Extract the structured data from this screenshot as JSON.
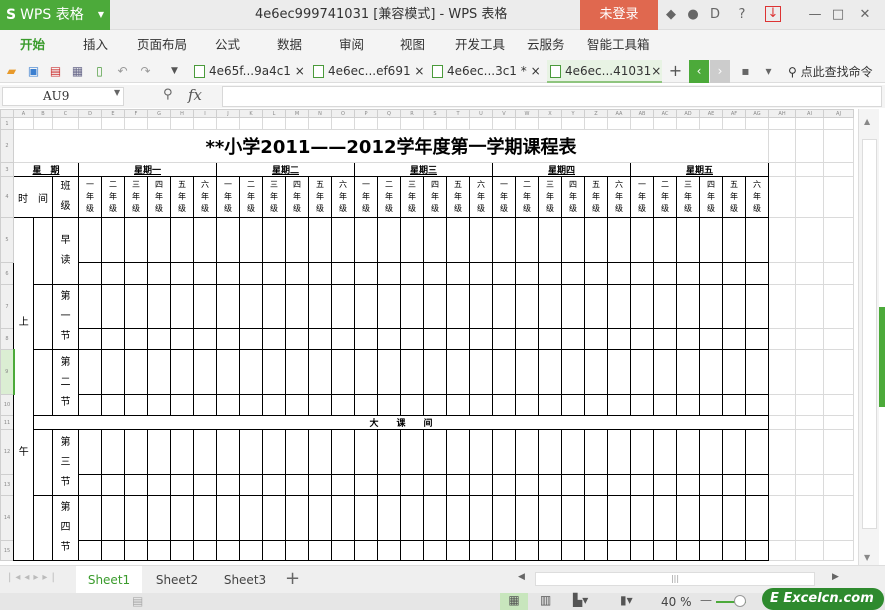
{
  "app": {
    "name": "WPS 表格",
    "logo_letter": "S",
    "doc_title": "4e6ec999741031 [兼容模式] - WPS 表格",
    "login": "未登录"
  },
  "menu": [
    "开始",
    "插入",
    "页面布局",
    "公式",
    "数据",
    "审阅",
    "视图",
    "开发工具",
    "云服务",
    "智能工具箱"
  ],
  "doc_tabs": [
    {
      "label": "4e65f...9a4c1 ×"
    },
    {
      "label": "4e6ec...ef691 ×"
    },
    {
      "label": "4e6ec...3c1 * ×"
    },
    {
      "label": "4e6ec...41031×"
    }
  ],
  "search_command": "点此查找命令",
  "formula": {
    "cell_ref": "AU9",
    "fx": "fx",
    "value": ""
  },
  "columns": [
    "A",
    "B",
    "C",
    "D",
    "E",
    "F",
    "G",
    "H",
    "I",
    "J",
    "K",
    "L",
    "M",
    "N",
    "O",
    "P",
    "Q",
    "R",
    "S",
    "T",
    "U",
    "V",
    "W",
    "X",
    "Y",
    "Z",
    "AA",
    "AB",
    "AC",
    "AD",
    "AE",
    "AF",
    "AG",
    "AH",
    "AI",
    "AJ"
  ],
  "rows": [
    "1",
    "2",
    "3",
    "4",
    "5",
    "6",
    "7",
    "8",
    "9",
    "10",
    "11",
    "12",
    "13",
    "14",
    "15"
  ],
  "sheet": {
    "title": "**小学2011——2012学年度第一学期课程表",
    "week_label": "星　期",
    "time_label": "时　间",
    "class_label": "班级",
    "days": [
      "星期一",
      "星期二",
      "星期三",
      "星期四",
      "星期五"
    ],
    "grades": [
      "一年级",
      "二年级",
      "三年级",
      "四年级",
      "五年级",
      "六年级"
    ],
    "morning_top": "上",
    "morning_bottom": "午",
    "periods": [
      "早读",
      "第一节",
      "第二节",
      "第三节",
      "第四节"
    ],
    "break_label": "大　　课　　间"
  },
  "sheet_tabs": [
    "Sheet1",
    "Sheet2",
    "Sheet3"
  ],
  "status": {
    "zoom": "40 %"
  },
  "watermark": "Excelcn.com"
}
